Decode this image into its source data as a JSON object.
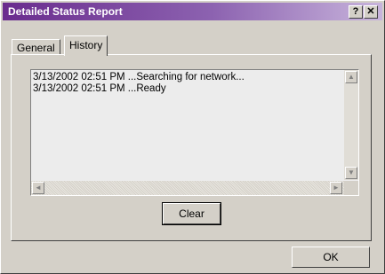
{
  "window": {
    "title": "Detailed Status Report",
    "help_button": "?",
    "close_button": "✕"
  },
  "tabs": [
    {
      "label": "General",
      "selected": false
    },
    {
      "label": "History",
      "selected": true
    }
  ],
  "history_log": {
    "lines": [
      "3/13/2002 02:51 PM ...Searching for network...",
      "3/13/2002 02:51 PM ...Ready"
    ]
  },
  "buttons": {
    "clear": "Clear",
    "ok": "OK"
  },
  "colors": {
    "titlebar_start": "#6a2c8e",
    "titlebar_end": "#c8b4dc",
    "face": "#d4d0c8"
  }
}
